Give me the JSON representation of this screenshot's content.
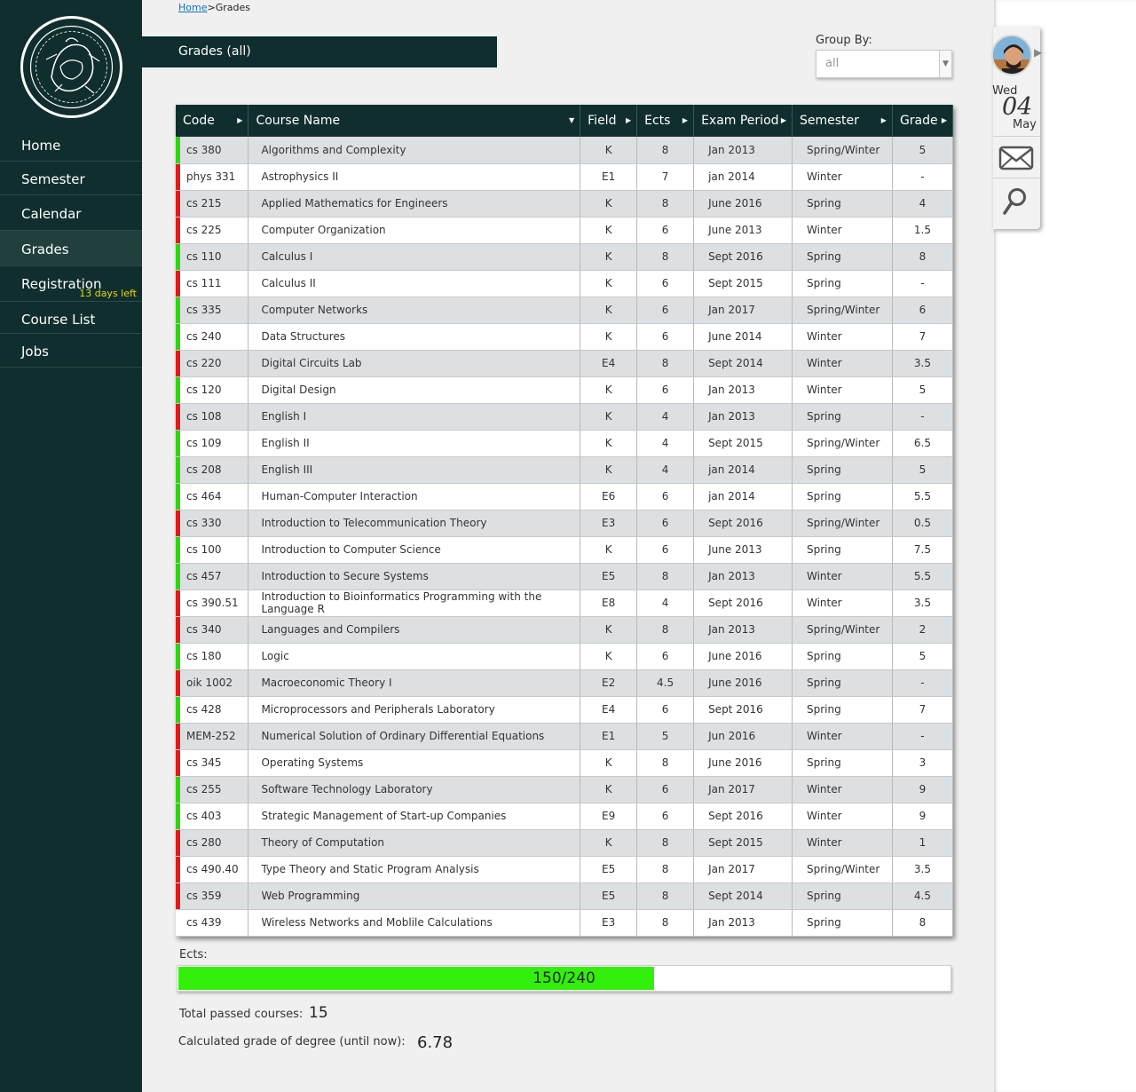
{
  "sidebar": {
    "items": [
      {
        "label": "Home"
      },
      {
        "label": "Semester"
      },
      {
        "label": "Calendar"
      },
      {
        "label": "Grades"
      },
      {
        "label": "Registration",
        "badge": "13 days left"
      },
      {
        "label": "Course List"
      },
      {
        "label": "Jobs"
      }
    ],
    "active": "Grades"
  },
  "breadcrumb": {
    "home": "Home",
    "separator": ">",
    "current": "Grades"
  },
  "page_title": "Grades (all)",
  "group_by": {
    "label": "Group By:",
    "value": "all"
  },
  "table": {
    "columns": [
      "Code",
      "Course Name",
      "Field",
      "Ects",
      "Exam Period",
      "Semester",
      "Grade"
    ],
    "rows": [
      {
        "code": "cs 380",
        "name": "Algorithms and Complexity",
        "field": "K",
        "ects": "8",
        "exam": "Jan 2013",
        "semester": "Spring/Winter",
        "grade": "5",
        "status": "pass"
      },
      {
        "code": "phys 331",
        "name": "Astrophysics II",
        "field": "E1",
        "ects": "7",
        "exam": "jan 2014",
        "semester": "Winter",
        "grade": "-",
        "status": "fail"
      },
      {
        "code": "cs 215",
        "name": "Applied Mathematics for Engineers",
        "field": "K",
        "ects": "8",
        "exam": "June 2016",
        "semester": "Spring",
        "grade": "4",
        "status": "fail"
      },
      {
        "code": "cs 225",
        "name": "Computer Organization",
        "field": "K",
        "ects": "6",
        "exam": "June 2013",
        "semester": "Winter",
        "grade": "1.5",
        "status": "fail"
      },
      {
        "code": "cs 110",
        "name": "Calculus I",
        "field": "K",
        "ects": "8",
        "exam": "Sept 2016",
        "semester": "Spring",
        "grade": "8",
        "status": "pass"
      },
      {
        "code": "cs 111",
        "name": "Calculus II",
        "field": "K",
        "ects": "6",
        "exam": "Sept 2015",
        "semester": "Spring",
        "grade": "-",
        "status": "fail"
      },
      {
        "code": "cs 335",
        "name": "Computer Networks",
        "field": "K",
        "ects": "6",
        "exam": "Jan 2017",
        "semester": "Spring/Winter",
        "grade": "6",
        "status": "pass"
      },
      {
        "code": "cs 240",
        "name": "Data Structures",
        "field": "K",
        "ects": "6",
        "exam": "June 2014",
        "semester": "Winter",
        "grade": "7",
        "status": "pass"
      },
      {
        "code": "cs 220",
        "name": "Digital Circuits Lab",
        "field": "E4",
        "ects": "8",
        "exam": "Sept 2014",
        "semester": "Winter",
        "grade": "3.5",
        "status": "fail"
      },
      {
        "code": "cs 120",
        "name": "Digital Design",
        "field": "K",
        "ects": "6",
        "exam": "Jan 2013",
        "semester": "Winter",
        "grade": "5",
        "status": "pass"
      },
      {
        "code": "cs 108",
        "name": "English I",
        "field": "K",
        "ects": "4",
        "exam": "Jan 2013",
        "semester": "Spring",
        "grade": "-",
        "status": "fail"
      },
      {
        "code": "cs 109",
        "name": "English II",
        "field": "K",
        "ects": "4",
        "exam": "Sept 2015",
        "semester": "Spring/Winter",
        "grade": "6.5",
        "status": "pass"
      },
      {
        "code": "cs 208",
        "name": "English III",
        "field": "K",
        "ects": "4",
        "exam": "jan 2014",
        "semester": "Spring",
        "grade": "5",
        "status": "pass"
      },
      {
        "code": "cs 464",
        "name": "Human-Computer Interaction",
        "field": "E6",
        "ects": "6",
        "exam": "jan 2014",
        "semester": "Spring",
        "grade": "5.5",
        "status": "pass"
      },
      {
        "code": "cs 330",
        "name": "Introduction to Telecommunication Theory",
        "field": "E3",
        "ects": "6",
        "exam": "Sept 2016",
        "semester": "Spring/Winter",
        "grade": "0.5",
        "status": "fail"
      },
      {
        "code": "cs 100",
        "name": "Introduction to Computer Science",
        "field": "K",
        "ects": "6",
        "exam": "June 2013",
        "semester": "Spring",
        "grade": "7.5",
        "status": "pass"
      },
      {
        "code": "cs 457",
        "name": "Introduction to Secure Systems",
        "field": "E5",
        "ects": "8",
        "exam": "Jan 2013",
        "semester": "Winter",
        "grade": "5.5",
        "status": "pass"
      },
      {
        "code": "cs 390.51",
        "name": "Introduction to Bioinformatics Programming with the Language R",
        "field": "E8",
        "ects": "4",
        "exam": "Sept 2016",
        "semester": "Winter",
        "grade": "3.5",
        "status": "fail"
      },
      {
        "code": "cs 340",
        "name": "Languages and Compilers",
        "field": "K",
        "ects": "8",
        "exam": "Jan 2013",
        "semester": "Spring/Winter",
        "grade": "2",
        "status": "fail"
      },
      {
        "code": "cs 180",
        "name": "Logic",
        "field": "K",
        "ects": "6",
        "exam": "June 2016",
        "semester": "Spring",
        "grade": "5",
        "status": "pass"
      },
      {
        "code": "oik 1002",
        "name": "Macroeconomic Theory I",
        "field": "E2",
        "ects": "4.5",
        "exam": "June 2016",
        "semester": "Spring",
        "grade": "-",
        "status": "fail"
      },
      {
        "code": "cs 428",
        "name": "Microprocessors and Peripherals Laboratory",
        "field": "E4",
        "ects": "6",
        "exam": "Sept 2016",
        "semester": "Spring",
        "grade": "7",
        "status": "pass"
      },
      {
        "code": "MEM-252",
        "name": "Numerical Solution of Ordinary Differential Equations",
        "field": "E1",
        "ects": "5",
        "exam": "Jun 2016",
        "semester": "Winter",
        "grade": "-",
        "status": "fail"
      },
      {
        "code": "cs 345",
        "name": "Operating Systems",
        "field": "K",
        "ects": "8",
        "exam": "June 2016",
        "semester": "Spring",
        "grade": "3",
        "status": "fail"
      },
      {
        "code": "cs 255",
        "name": "Software Technology Laboratory",
        "field": "K",
        "ects": "6",
        "exam": "Jan 2017",
        "semester": "Winter",
        "grade": "9",
        "status": "pass"
      },
      {
        "code": "cs 403",
        "name": "Strategic Management of Start-up Companies",
        "field": "E9",
        "ects": "6",
        "exam": "Sept 2016",
        "semester": "Winter",
        "grade": "9",
        "status": "pass"
      },
      {
        "code": "cs 280",
        "name": "Theory of Computation",
        "field": "K",
        "ects": "8",
        "exam": "Sept 2015",
        "semester": "Winter",
        "grade": "1",
        "status": "fail"
      },
      {
        "code": "cs 490.40",
        "name": "Type Theory and Static Program Analysis",
        "field": "E5",
        "ects": "8",
        "exam": "Jan 2017",
        "semester": "Spring/Winter",
        "grade": "3.5",
        "status": "fail"
      },
      {
        "code": "cs 359",
        "name": "Web Programming",
        "field": "E5",
        "ects": "8",
        "exam": "Sept 2014",
        "semester": "Spring",
        "grade": "4.5",
        "status": "fail"
      },
      {
        "code": "cs 439",
        "name": "Wireless Networks and Moblile Calculations",
        "field": "E3",
        "ects": "8",
        "exam": "Jan 2013",
        "semester": "Spring",
        "grade": "8",
        "status": "none"
      }
    ]
  },
  "ects": {
    "label": "Ects:",
    "text": "150/240",
    "fraction": 0.625
  },
  "summary": {
    "passed_label": "Total passed courses:",
    "passed_value": "15",
    "degree_label": "Calculated grade of degree (until now):",
    "degree_value": "6.78"
  },
  "widget": {
    "day": "Wed",
    "date": "04",
    "month": "May"
  },
  "colors": {
    "sidebar_bg": "#0f2e2d",
    "pass": "#2fd50f",
    "fail": "#e01b1b",
    "progress": "#33f00c",
    "badge": "#e8d80a"
  },
  "icons": [
    "logo-seal",
    "sort-arrow-icon",
    "dropdown-arrow-icon",
    "avatar",
    "mail-icon",
    "search-icon"
  ]
}
